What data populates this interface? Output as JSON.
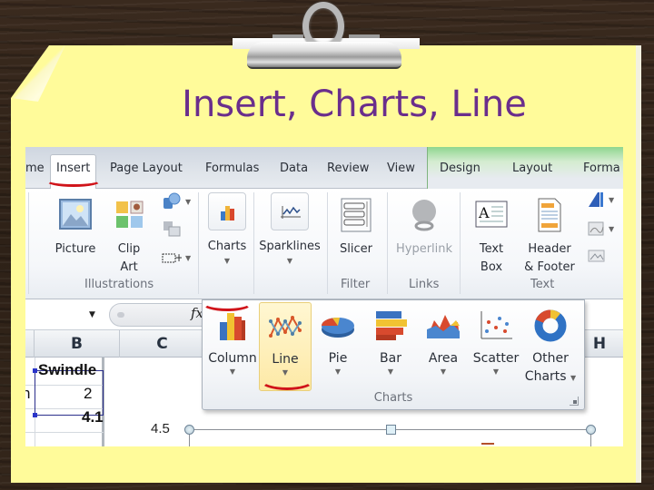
{
  "slide": {
    "title": "Insert, Charts, Line"
  },
  "excel": {
    "tabs": [
      {
        "label": "me",
        "active": false
      },
      {
        "label": "Insert",
        "active": true
      },
      {
        "label": "Page Layout",
        "active": false
      },
      {
        "label": "Formulas",
        "active": false
      },
      {
        "label": "Data",
        "active": false
      },
      {
        "label": "Review",
        "active": false
      },
      {
        "label": "View",
        "active": false
      }
    ],
    "context_tabs": [
      {
        "label": "Design"
      },
      {
        "label": "Layout"
      },
      {
        "label": "Forma"
      }
    ],
    "ribbon": {
      "groups": [
        {
          "label": "Illustrations"
        },
        {
          "label": "Filter"
        },
        {
          "label": "Links"
        },
        {
          "label": "Text"
        }
      ],
      "buttons": {
        "picture": "Picture",
        "clip_art_line1": "Clip",
        "clip_art_line2": "Art",
        "charts": "Charts",
        "sparklines": "Sparklines",
        "slicer": "Slicer",
        "hyperlink": "Hyperlink",
        "text_box_line1": "Text",
        "text_box_line2": "Box",
        "header_footer_line1": "Header",
        "header_footer_line2": "& Footer"
      }
    },
    "formula_bar": {
      "fx_label": "fx"
    },
    "columns": [
      "B",
      "C",
      "H"
    ],
    "cells": {
      "b1": "Swindle",
      "b2": "2",
      "b3": "4.1",
      "a2_fragment": "n"
    },
    "charts_gallery": {
      "group_label": "Charts",
      "items": [
        {
          "label": "Column"
        },
        {
          "label": "Line",
          "highlighted": true
        },
        {
          "label": "Pie"
        },
        {
          "label": "Bar"
        },
        {
          "label": "Area"
        },
        {
          "label": "Scatter"
        },
        {
          "label_line1": "Other",
          "label_line2": "Charts"
        }
      ]
    },
    "chart": {
      "y_axis_tick": "4.5"
    }
  },
  "colors": {
    "title": "#6a2e8c",
    "note": "#fffb9a",
    "pen_mark": "#d0141a",
    "gallery_hover": "#fde9a6",
    "context_tab_green": "#8fd68f"
  }
}
